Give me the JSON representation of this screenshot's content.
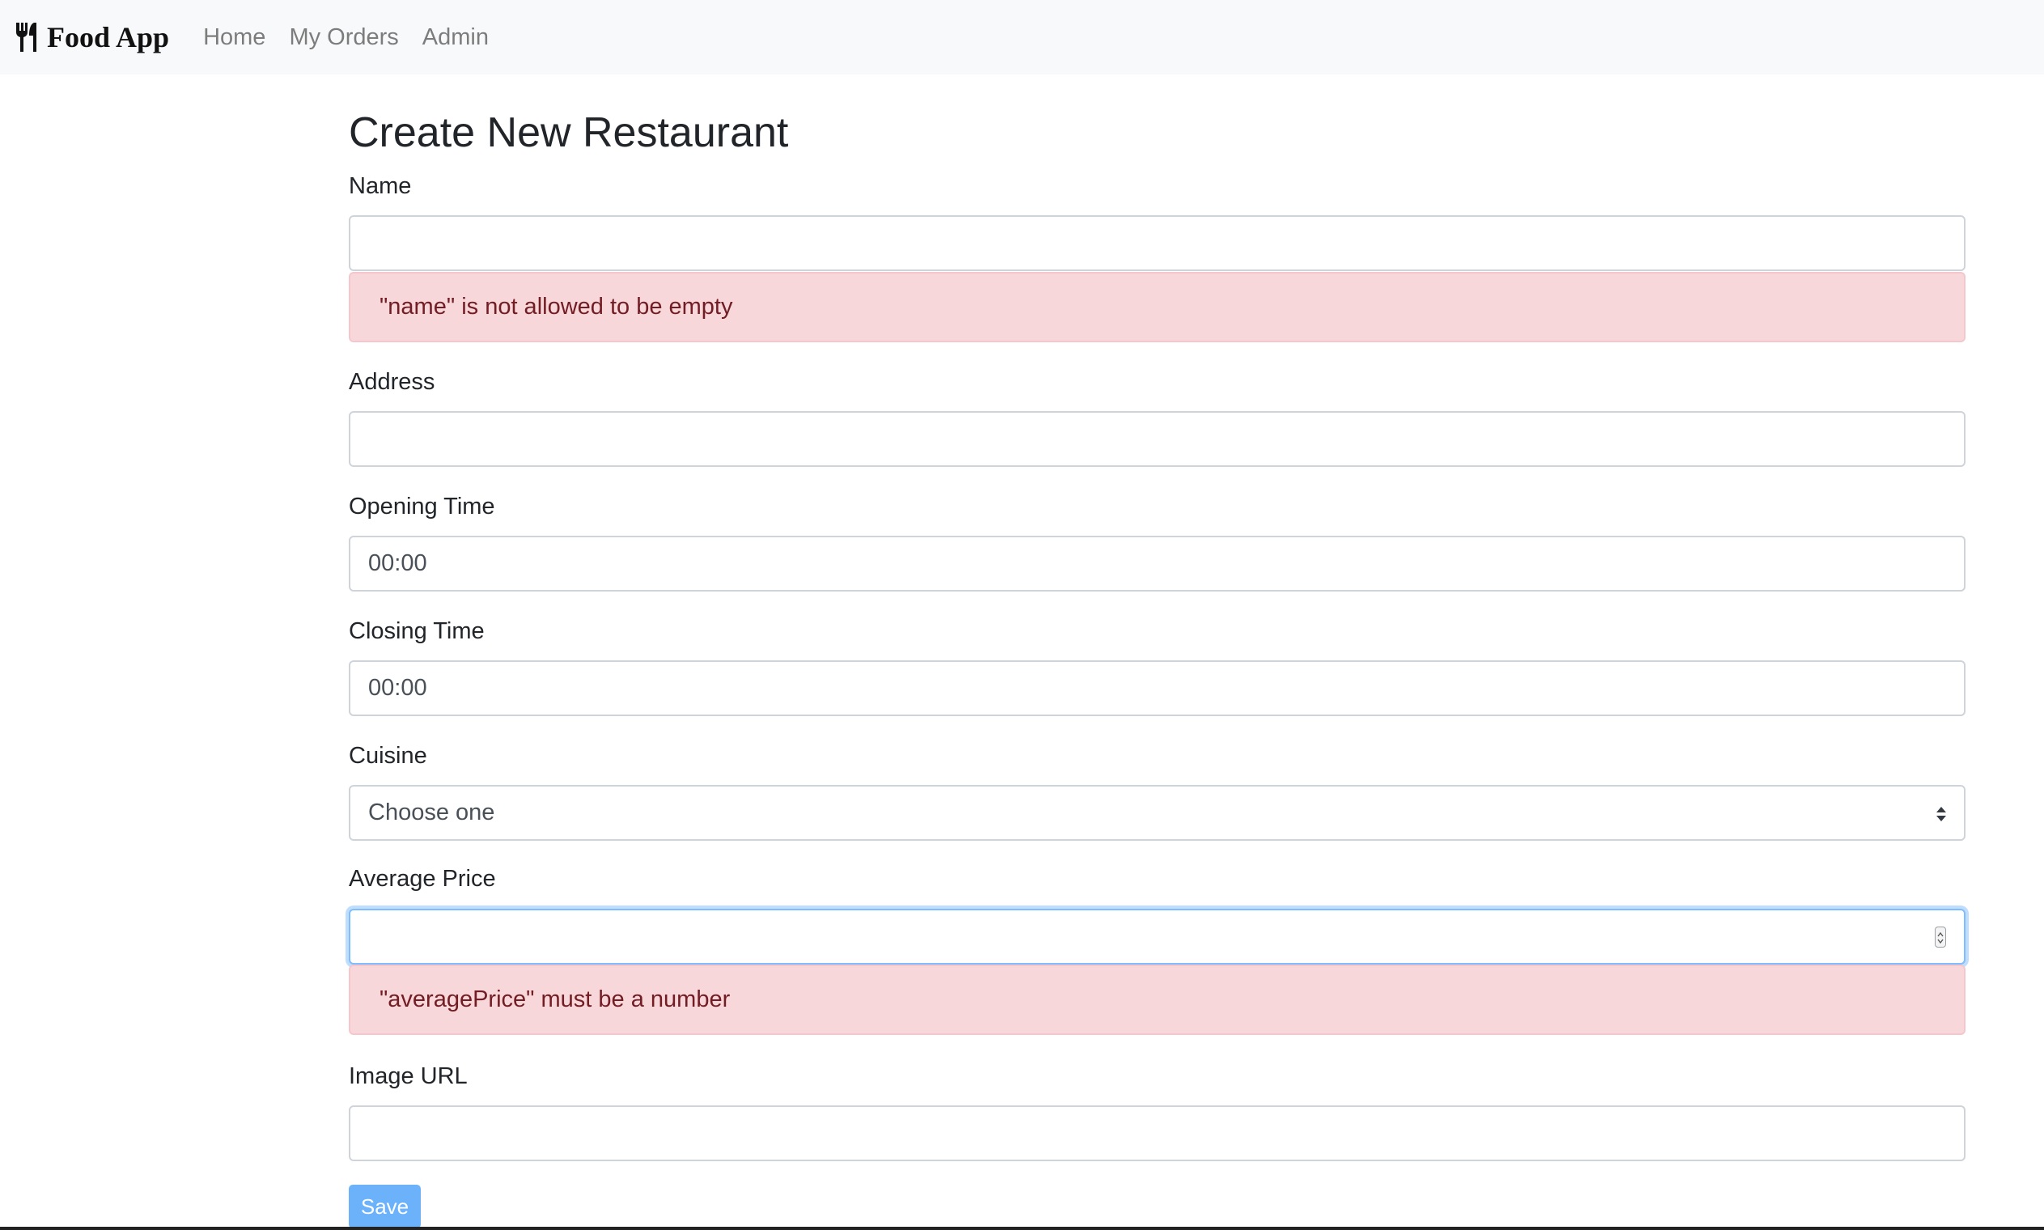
{
  "navbar": {
    "brand": "Food App",
    "brand_icon": "fork-knife-icon",
    "links": [
      "Home",
      "My Orders",
      "Admin"
    ]
  },
  "page": {
    "title": "Create New Restaurant"
  },
  "form": {
    "name": {
      "label": "Name",
      "value": "",
      "error": "\"name\" is not allowed to be empty"
    },
    "address": {
      "label": "Address",
      "value": ""
    },
    "opening_time": {
      "label": "Opening Time",
      "value": "00:00"
    },
    "closing_time": {
      "label": "Closing Time",
      "value": "00:00"
    },
    "cuisine": {
      "label": "Cuisine",
      "selected": "Choose one"
    },
    "average_price": {
      "label": "Average Price",
      "value": "",
      "error": "\"averagePrice\" must be a number"
    },
    "image_url": {
      "label": "Image URL",
      "value": ""
    },
    "save_label": "Save"
  },
  "colors": {
    "navbar_bg": "#f8f9fa",
    "alert_bg": "#f8d7da",
    "alert_text": "#721c24",
    "focus_border": "#80bdff",
    "button_bg": "#6cb2fb"
  }
}
